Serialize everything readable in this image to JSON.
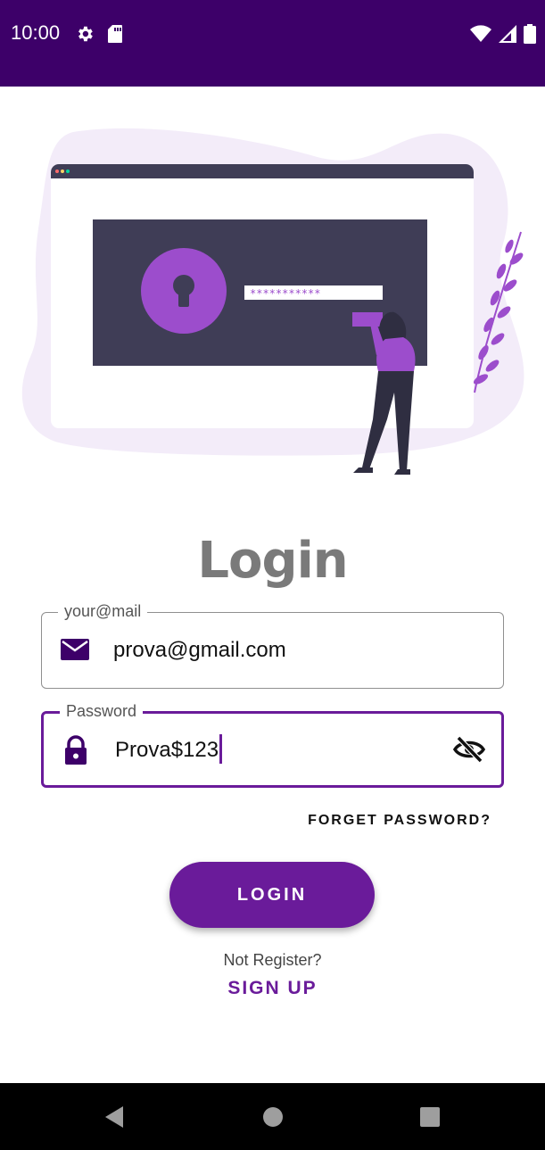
{
  "status_bar": {
    "time": "10:00",
    "left_icons": [
      "gear-icon",
      "sd-card-icon"
    ],
    "right_icons": [
      "wifi-icon",
      "cellular-signal-icon",
      "battery-icon"
    ],
    "background_color": "#3d0069"
  },
  "illustration": {
    "password_mask": "***********",
    "icons": [
      "browser-window",
      "keyhole-icon",
      "woman-figure",
      "leaf-branch"
    ]
  },
  "title": "Login",
  "email_field": {
    "label": "your@mail",
    "value": "prova@gmail.com",
    "icon": "mail-icon"
  },
  "password_field": {
    "label": "Password",
    "value": "Prova$123",
    "icon": "lock-icon",
    "toggle_icon": "eye-off-icon",
    "focused": true
  },
  "forget_password_label": "FORGET PASSWORD?",
  "login_button_label": "LOGIN",
  "not_register_text": "Not Register?",
  "sign_up_label": "SIGN UP",
  "nav_bar": {
    "buttons": [
      "back-icon",
      "home-icon",
      "recents-icon"
    ]
  },
  "colors": {
    "accent": "#6a1b9a",
    "dark_purple": "#3d0069",
    "illustration_purple": "#9c4dcc",
    "illustration_dark": "#3f3d56",
    "blob": "#f3ecf9"
  }
}
